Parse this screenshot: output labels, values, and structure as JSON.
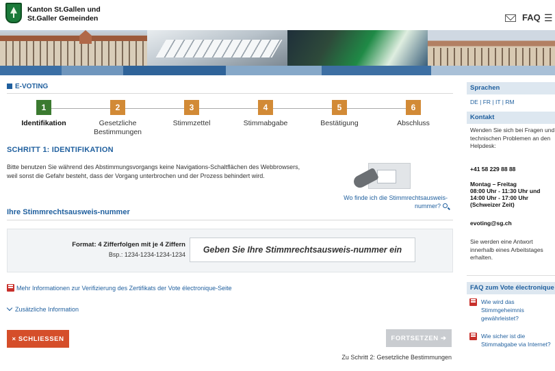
{
  "header": {
    "org_line1": "Kanton St.Gallen und",
    "org_line2": "St.Galler Gemeinden",
    "faq_label": "FAQ",
    "menu_glyph": "☰"
  },
  "main": {
    "section_label": "E-VOTING",
    "steps": [
      {
        "number": "1",
        "label": "Identifikation",
        "active": true
      },
      {
        "number": "2",
        "label": "Gesetzliche Bestimmungen"
      },
      {
        "number": "3",
        "label": "Stimmzettel"
      },
      {
        "number": "4",
        "label": "Stimmabgabe"
      },
      {
        "number": "5",
        "label": "Bestätigung"
      },
      {
        "number": "6",
        "label": "Abschluss"
      }
    ],
    "step_title": "SCHRITT 1: IDENTIFIKATION",
    "intro_text": "Bitte benutzen Sie während des Abstimmungsvorgangs keine Navigations-Schaltflächen des Webbrowsers, weil sonst die Gefahr besteht, dass der Vorgang unterbrochen und der Prozess behindert wird.",
    "where_link": "Wo finde ich die Stimmrechtsausweis-nummer?",
    "field_title": "Ihre Stimmrechtsausweis-nummer",
    "format_text": "Format: 4 Zifferfolgen mit je 4 Ziffern",
    "format_example": "Bsp.: 1234-1234-1234-1234",
    "input_placeholder": "Geben Sie Ihre Stimmrechtsausweis-nummer ein",
    "more_info_link": "Mehr Informationen zur Verifizierung des Zertifikats der Vote électronique-Seite",
    "extra_info_link": "Zusätzliche Information",
    "close_button": "× SCHLIESSEN",
    "next_button": "FORTSETZEN ➔",
    "next_hint": "Zu Schritt 2: Gesetzliche Bestimmungen"
  },
  "sidebar": {
    "languages_title": "Sprachen",
    "languages": "DE | FR | IT | RM",
    "contact_title": "Kontakt",
    "contact_intro": "Wenden Sie sich bei Fragen und technischen Problemen an den Helpdesk:",
    "phone": "+41 58 229 88 88",
    "hours_line1": "Montag – Freitag",
    "hours_line2": "08:00 Uhr - 11:30 Uhr und",
    "hours_line3": "14:00 Uhr - 17:00 Uhr",
    "hours_line4": "(Schweizer Zeit)",
    "email": "evoting@sg.ch",
    "reply_note": "Sie werden eine Antwort innerhalb eines Arbeitstages erhalten.",
    "faq_title": "FAQ zum Vote électronique",
    "faq_items": [
      "Wie wird das Stimmgeheimnis gewährleistet?",
      "Wie sicher ist die Stimmabgabe via Internet?"
    ]
  },
  "colors": {
    "brand_blue": "#1f5f9e",
    "step_active": "#3b7a30",
    "step_inactive": "#d28a36",
    "close_button": "#d54e2a",
    "next_button_disabled": "#c9ccd0"
  }
}
